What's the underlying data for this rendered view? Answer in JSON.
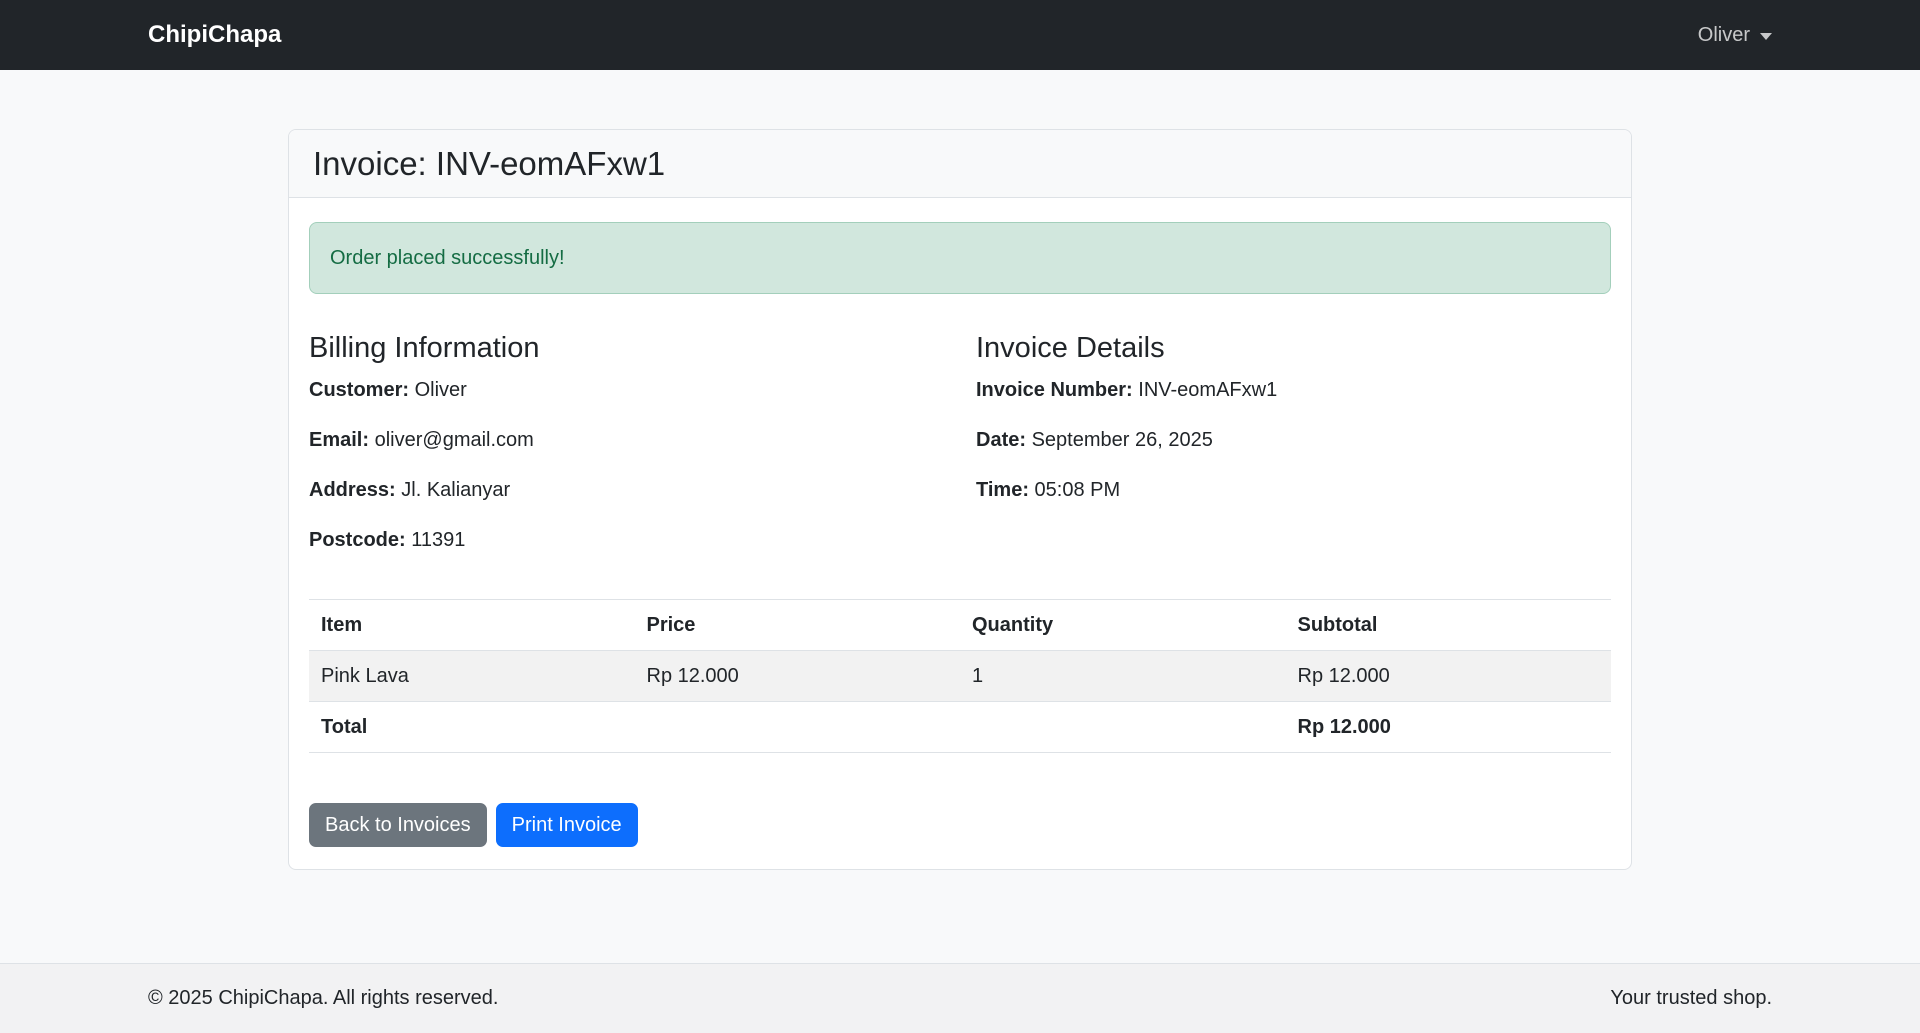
{
  "navbar": {
    "brand": "ChipiChapa",
    "user_menu": {
      "label": "Oliver",
      "icon": "caret-down-icon"
    }
  },
  "invoice_card": {
    "title": "Invoice: INV-eomAFxw1",
    "alert": {
      "type": "success",
      "message": "Order placed successfully!"
    },
    "billing": {
      "heading": "Billing Information",
      "fields": [
        {
          "label": "Customer:",
          "value": "Oliver"
        },
        {
          "label": "Email:",
          "value": "oliver@gmail.com"
        },
        {
          "label": "Address:",
          "value": "Jl. Kalianyar"
        },
        {
          "label": "Postcode:",
          "value": "11391"
        }
      ]
    },
    "details": {
      "heading": "Invoice Details",
      "fields": [
        {
          "label": "Invoice Number:",
          "value": "INV-eomAFxw1"
        },
        {
          "label": "Date:",
          "value": "September 26, 2025"
        },
        {
          "label": "Time:",
          "value": "05:08 PM"
        }
      ]
    },
    "items_table": {
      "headers": [
        "Item",
        "Price",
        "Quantity",
        "Subtotal"
      ],
      "rows": [
        {
          "item": "Pink Lava",
          "price": "Rp 12.000",
          "quantity": "1",
          "subtotal": "Rp 12.000"
        }
      ],
      "total_label": "Total",
      "total_value": "Rp 12.000"
    },
    "actions": {
      "back_label": "Back to Invoices",
      "print_label": "Print Invoice"
    }
  },
  "footer": {
    "copyright": "© 2025 ChipiChapa. All rights reserved.",
    "tagline": "Your trusted shop."
  },
  "colors": {
    "navbar_bg": "#212529",
    "page_bg": "#f8f9fa",
    "alert_bg": "#d1e7dd",
    "alert_border": "#a3cfbb",
    "alert_text": "#146c43",
    "primary": "#0d6efd",
    "secondary": "#6c757d",
    "table_border": "#dee2e6",
    "striped_row_bg": "#f2f2f2",
    "footer_bg": "#f2f2f3"
  }
}
